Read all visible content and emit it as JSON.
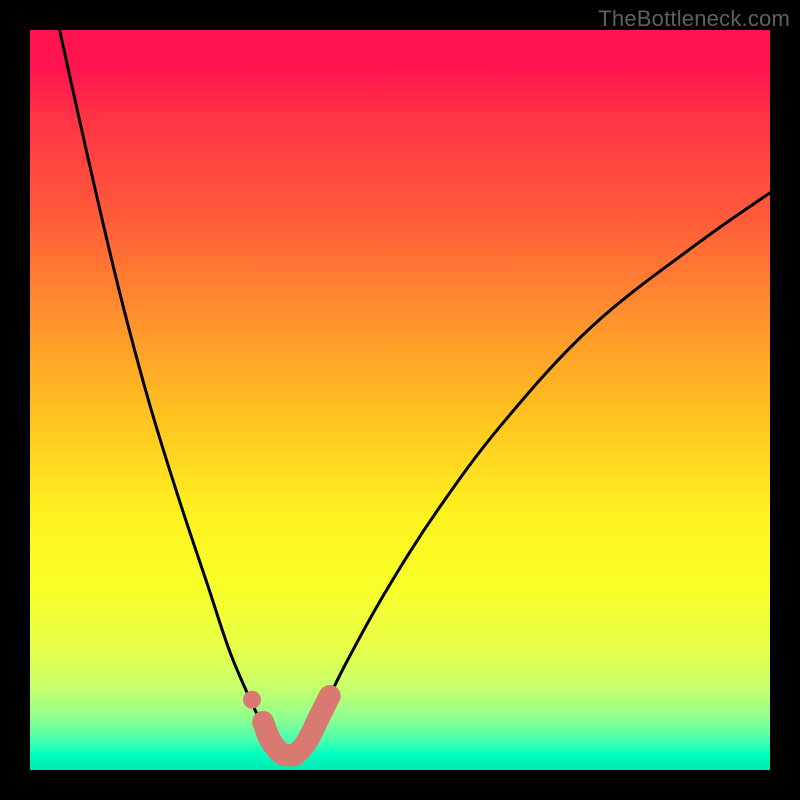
{
  "watermark": "TheBottleneck.com",
  "chart_data": {
    "type": "line",
    "title": "",
    "xlabel": "",
    "ylabel": "",
    "xlim": [
      0,
      100
    ],
    "ylim": [
      0,
      100
    ],
    "series": [
      {
        "name": "bottleneck-curve",
        "x": [
          4,
          8,
          12,
          16,
          20,
          24,
          27,
          30,
          32,
          33.5,
          35,
          36.5,
          38,
          40,
          43,
          48,
          55,
          64,
          76,
          90,
          100
        ],
        "y": [
          100,
          82,
          65,
          50,
          37,
          25,
          16,
          9,
          5,
          3,
          2,
          3,
          5,
          9,
          15,
          24,
          35,
          47,
          60,
          71,
          78
        ]
      }
    ],
    "marker_points": {
      "name": "highlight-band",
      "color": "#d97a72",
      "left_dot": {
        "x": 30.0,
        "y": 9.5
      },
      "path": [
        {
          "x": 31.5,
          "y": 6.5
        },
        {
          "x": 32.5,
          "y": 4.0
        },
        {
          "x": 34.0,
          "y": 2.2
        },
        {
          "x": 35.0,
          "y": 2.0
        },
        {
          "x": 36.0,
          "y": 2.2
        },
        {
          "x": 37.5,
          "y": 4.0
        },
        {
          "x": 39.0,
          "y": 7.0
        },
        {
          "x": 40.5,
          "y": 10.0
        }
      ]
    }
  }
}
